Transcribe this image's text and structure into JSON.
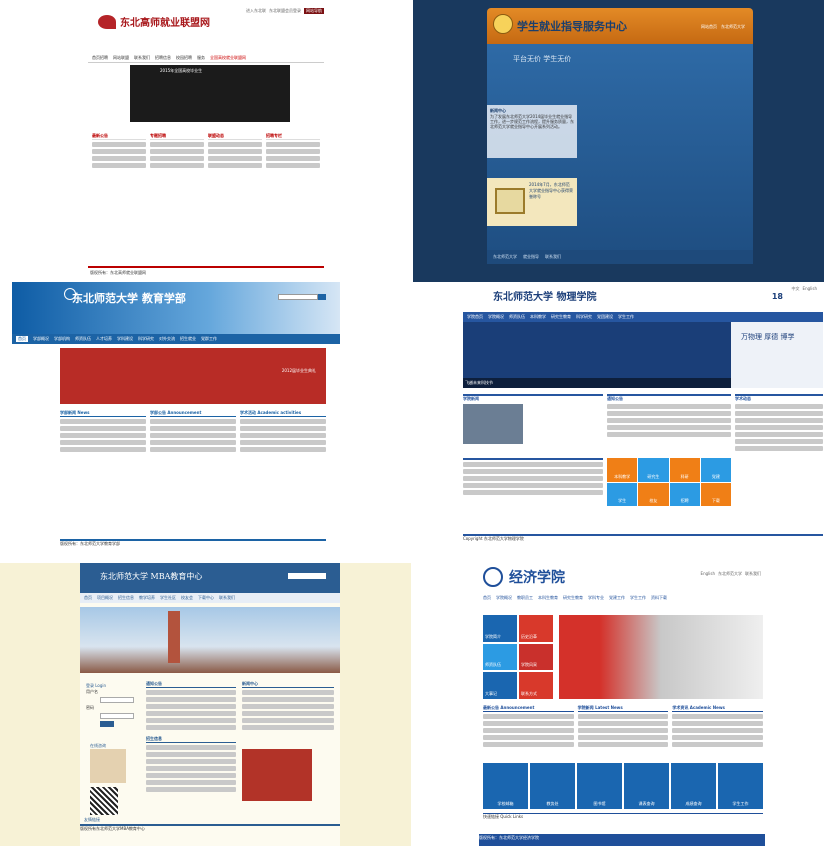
{
  "panel_a": {
    "site_name": "东北高师就业联盟网",
    "top_links": [
      "进入东北联",
      "东北联盟会员登录"
    ],
    "top_select": "网站导航",
    "nav_items": [
      "首页招聘",
      "网站联盟",
      "联系我们",
      "招聘信息",
      "校园招聘",
      "服务"
    ],
    "nav_highlight": "全国高校就业联盟网",
    "columns": [
      "最新公告",
      "专题招聘",
      "联盟动态",
      "招聘专栏"
    ],
    "banner_caption": "2015年全国高校毕业生",
    "footer": "版权所有：东北高师就业联盟网"
  },
  "panel_b": {
    "title": "学生就业指导服务中心",
    "header_links": [
      "网站首页",
      "东北师范大学"
    ],
    "motto": "平台无价 学生无价",
    "news_heading": "新闻中心",
    "news_text": "为了发展东北师范大学2014届毕业生就业指导工作，进一步规范工作流程，提升服务质量，东北师范大学就业指导中心开展系列活动。",
    "notice_caption": "2014年7月，东北师范大学就业指导中心获得荣誉称号",
    "footer_links": [
      "东北师范大学",
      "就业指导",
      "联系我们"
    ]
  },
  "panel_c": {
    "title": "东北师范大学 教育学部",
    "nav_items": [
      "首页",
      "学部概况",
      "学部机构",
      "师资队伍",
      "人才培养",
      "学科建设",
      "科学研究",
      "对外交流",
      "招生就业",
      "党群工作"
    ],
    "banner_caption": "2012届毕业生典礼",
    "columns": [
      "学部新闻 News",
      "学部公告 Announcement",
      "学术活动 Academic activities"
    ],
    "footer": "版权所有：东北师范大学教育学部"
  },
  "panel_d": {
    "title": "东北师范大学 物理学院",
    "top_links": [
      "中文",
      "English"
    ],
    "date": "18",
    "nav_items": [
      "学院首页",
      "学院概况",
      "师资队伍",
      "本科教学",
      "研究生教育",
      "科学研究",
      "党团建设",
      "学生工作"
    ],
    "hero_caption": "飞越未来科技节",
    "side_calligraphy": "万物理 厚德 博学",
    "boxes": [
      "学院新闻",
      "通知公告",
      "学术动态"
    ],
    "tiles": [
      "本科教学",
      "研究生",
      "科研",
      "党建",
      "学生",
      "校友",
      "招聘",
      "下载"
    ],
    "footer": "Copyright 东北师范大学物理学院"
  },
  "panel_e": {
    "title": "东北师范大学 MBA教育中心",
    "nav_items": [
      "首页",
      "项目概况",
      "招生信息",
      "教学培养",
      "学生社区",
      "校友会",
      "下载中心",
      "联系我们"
    ],
    "login_title": "登录 Login",
    "login_labels": [
      "用户名",
      "密码"
    ],
    "consult_title": "在线咨询",
    "news_heading": "通知公告",
    "news2_heading": "新闻中心",
    "recruit_heading": "招生信息",
    "links_heading": "友情链接",
    "footer": "版权所有东北师范大学MBA教育中心"
  },
  "panel_f": {
    "title": "经济学院",
    "top_links": [
      "English",
      "东北师范大学",
      "联系我们"
    ],
    "nav_items": [
      "首页",
      "学院概况",
      "教职员工",
      "本科生教育",
      "研究生教育",
      "学科专业",
      "党建工作",
      "学生工作",
      "资料下载"
    ],
    "tiles": [
      "学院简介",
      "历史沿革",
      "师资队伍",
      "学院风采",
      "大事记",
      "联系方式"
    ],
    "lists": [
      "最新公告 Announcement",
      "学院新闻 Latest News",
      "学术资讯 Academic News"
    ],
    "services": [
      "学校邮箱",
      "教务处",
      "图书馆",
      "课表查询",
      "成绩查询",
      "学生工作"
    ],
    "quick_links": "快速链接 Quick Links",
    "footer": "版权所有：东北师范大学经济学院"
  }
}
